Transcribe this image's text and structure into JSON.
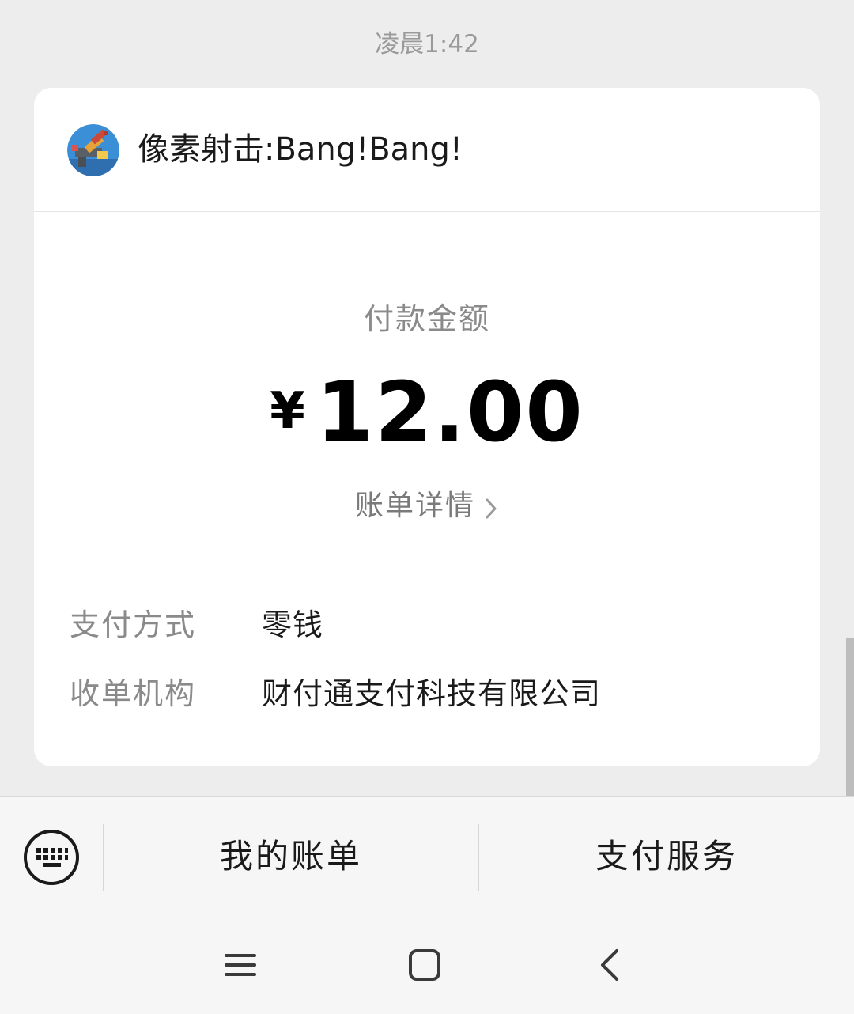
{
  "timestamp": "凌晨1:42",
  "header": {
    "app_name": "像素射击:Bang!Bang!",
    "app_icon": "pixel-gun-game-icon"
  },
  "payment": {
    "amount_label": "付款金额",
    "currency_symbol": "¥",
    "amount": "12.00",
    "details_link": "账单详情"
  },
  "info": [
    {
      "label": "支付方式",
      "value": "零钱"
    },
    {
      "label": "收单机构",
      "value": "财付通支付科技有限公司"
    }
  ],
  "bottom_menu": {
    "keyboard_icon": "keyboard-icon",
    "items": [
      {
        "label": "我的账单"
      },
      {
        "label": "支付服务"
      }
    ]
  },
  "nav": {
    "icons": [
      "menu-icon",
      "home-icon",
      "back-icon"
    ]
  },
  "colors": {
    "background": "#ededed",
    "card": "#ffffff",
    "muted_text": "#8a8a8a",
    "primary_text": "#1a1a1a"
  }
}
